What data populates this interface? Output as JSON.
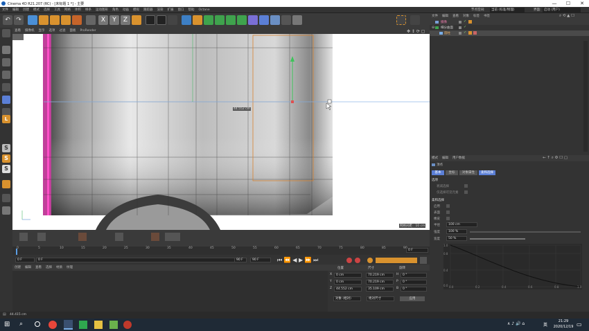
{
  "window": {
    "title": "Cinema 4D R21.207 (RC) - [未标题 1 *] - 主要",
    "min": "—",
    "max": "☐",
    "close": "✕"
  },
  "menu": [
    "文件",
    "编辑",
    "创建",
    "模式",
    "选择",
    "工具",
    "网格",
    "体积",
    "样条",
    "运动图形",
    "角色",
    "动画",
    "模拟",
    "跟踪器",
    "渲染",
    "扩展",
    "窗口",
    "帮助",
    "Octane"
  ],
  "topright": {
    "node_space_label": "节点空间:",
    "node_space_value": "当前 (标准/物理)",
    "layout_label": "界面:",
    "layout_value": "启动 (用户)"
  },
  "viewport": {
    "menu": [
      "查看",
      "摄像机",
      "显示",
      "选项",
      "过滤",
      "面板",
      "ProRender"
    ],
    "measure_label": "44.552 cm",
    "grid_label": "网格间距 : 10 cm"
  },
  "object_manager": {
    "menu": [
      "文件",
      "编辑",
      "查看",
      "对象",
      "标签",
      "书签"
    ],
    "objects": [
      {
        "name": "摄像"
      },
      {
        "name": "细分曲面"
      },
      {
        "name": "圆柱"
      }
    ]
  },
  "attribute_manager": {
    "menu": [
      "模式",
      "编辑",
      "用户数据"
    ],
    "section": "顶点",
    "tabs": [
      "基本",
      "坐标",
      "对象属性",
      "柔和选择"
    ],
    "group1": "选项",
    "opt1": "衰减选择",
    "opt2": "仅选择可见元素",
    "group2": "柔和选择",
    "labels": [
      "启用",
      "表面",
      "橡皮",
      "半径",
      "强度",
      "宽度"
    ],
    "radius_value": "100 cm",
    "strength_value": "100 %",
    "width_value": "50 %",
    "graph_y": [
      "1.0",
      "0.8",
      "0.4",
      "0.0"
    ],
    "graph_x": [
      "0.0",
      "0.2",
      "0.4",
      "0.6",
      "0.8",
      "1.0"
    ]
  },
  "timeline": {
    "ticks": [
      "0",
      "5",
      "10",
      "15",
      "20",
      "25",
      "30",
      "35",
      "40",
      "45",
      "50",
      "55",
      "60",
      "65",
      "70",
      "75",
      "80",
      "85",
      "90"
    ],
    "frame_current": "0 F",
    "frame_start": "0 F",
    "frame_end": "90 F",
    "frame_end2": "90 F",
    "frame_right": "0 F"
  },
  "material_manager": {
    "menu": [
      "创建",
      "编辑",
      "查看",
      "选择",
      "材质",
      "纹理"
    ]
  },
  "coordinates": {
    "headers": [
      "位置",
      "尺寸",
      "旋转"
    ],
    "rows": [
      {
        "axis": "X",
        "pos": "0 cm",
        "size": "70.219 cm",
        "rlabel": "H",
        "rot": "0 °"
      },
      {
        "axis": "Y",
        "pos": "0 cm",
        "size": "70.219 cm",
        "rlabel": "P",
        "rot": "0 °"
      },
      {
        "axis": "Z",
        "pos": "44.552 cm",
        "size": "35.109 cm",
        "rlabel": "B",
        "rot": "0 °"
      }
    ],
    "mode1": "对象 (相对)",
    "mode2": "绝对尺寸",
    "apply": "应用"
  },
  "status": {
    "text": "44.415 cm"
  },
  "taskbar": {
    "time": "21:29",
    "date": "2020/12/19",
    "lang": "英"
  }
}
